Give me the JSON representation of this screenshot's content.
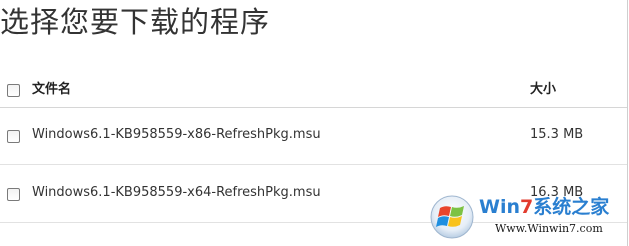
{
  "page": {
    "title": "选择您要下载的程序"
  },
  "table": {
    "header": {
      "select_all_checked": false,
      "name_label": "文件名",
      "size_label": "大小"
    },
    "rows": [
      {
        "name": "Windows6.1-KB958559-x86-RefreshPkg.msu",
        "size": "15.3 MB",
        "checked": false
      },
      {
        "name": "Windows6.1-KB958559-x64-RefreshPkg.msu",
        "size": "16.3 MB",
        "checked": false
      }
    ]
  },
  "watermark": {
    "brand_part1": "Win",
    "brand_part2": "7",
    "brand_part3": "系统之家",
    "url": "Www.Winwin7.com",
    "logo_icon": "windows-flag-icon"
  },
  "colors": {
    "title": "#333333",
    "checkbox_border": "#7a7a7a",
    "row_divider": "#e2e2e2",
    "brand_blue": "#2a7fd0",
    "brand_red": "#e23b2e"
  }
}
